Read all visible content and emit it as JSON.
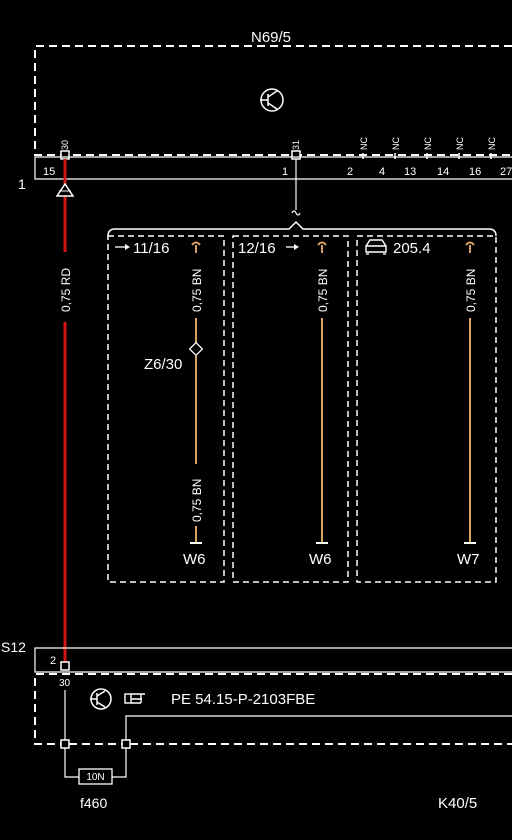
{
  "colors": {
    "background": "#000000",
    "line": "#ffffff",
    "power_wire": "#d21414",
    "signal_wire": "#d9a066"
  },
  "top_module": {
    "name": "N69/5",
    "ground_row": "1",
    "pin_30": "30",
    "pin_31": "31",
    "nc": "NC",
    "connectors": [
      "15",
      "1",
      "2",
      "4",
      "13",
      "14",
      "16",
      "27"
    ]
  },
  "main_wire": {
    "label": "0,75 RD"
  },
  "variants": {
    "col1": {
      "ref": "11/16",
      "wire_upper": "0,75 BN",
      "wire_lower": "0,75 BN",
      "splice": "Z6/30",
      "ground": "W6"
    },
    "col2": {
      "ref": "12/16",
      "wire": "0,75 BN",
      "ground": "W6"
    },
    "col3": {
      "model": "205.4",
      "wire": "0,75 BN",
      "ground": "W7"
    }
  },
  "bottom_module": {
    "bus": "S12",
    "bus_pin": "2",
    "pin_30": "30",
    "reference": "PE 54.15-P-2103FBE",
    "fuse_rating": "10N",
    "fuse_name": "f460",
    "relay_name": "K40/5"
  }
}
